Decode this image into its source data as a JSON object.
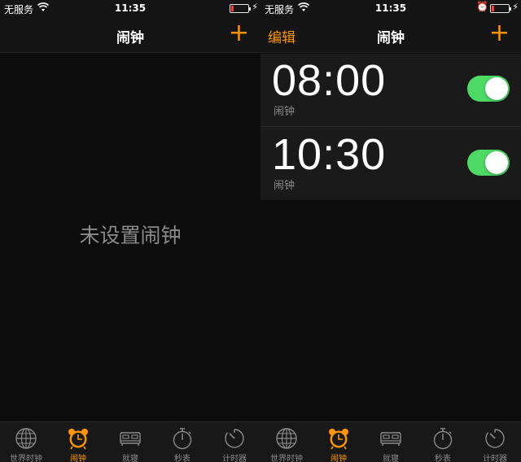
{
  "status": {
    "carrier": "无服务",
    "time": "11:35"
  },
  "left": {
    "title": "闹钟",
    "add": "+",
    "empty_message": "未设置闹钟"
  },
  "right": {
    "edit": "编辑",
    "title": "闹钟",
    "add": "+",
    "alarms": [
      {
        "time": "08:00",
        "label": "闹钟",
        "enabled": true
      },
      {
        "time": "10:30",
        "label": "闹钟",
        "enabled": true
      }
    ]
  },
  "tabs": [
    {
      "label": "世界时钟",
      "icon": "globe-icon"
    },
    {
      "label": "闹钟",
      "icon": "alarm-clock-icon",
      "active": true
    },
    {
      "label": "就寝",
      "icon": "bed-icon"
    },
    {
      "label": "秒表",
      "icon": "stopwatch-icon"
    },
    {
      "label": "计时器",
      "icon": "timer-icon"
    }
  ],
  "colors": {
    "accent": "#ff9500",
    "toggle_on": "#4cd964",
    "battery_low": "#ff3b30"
  }
}
